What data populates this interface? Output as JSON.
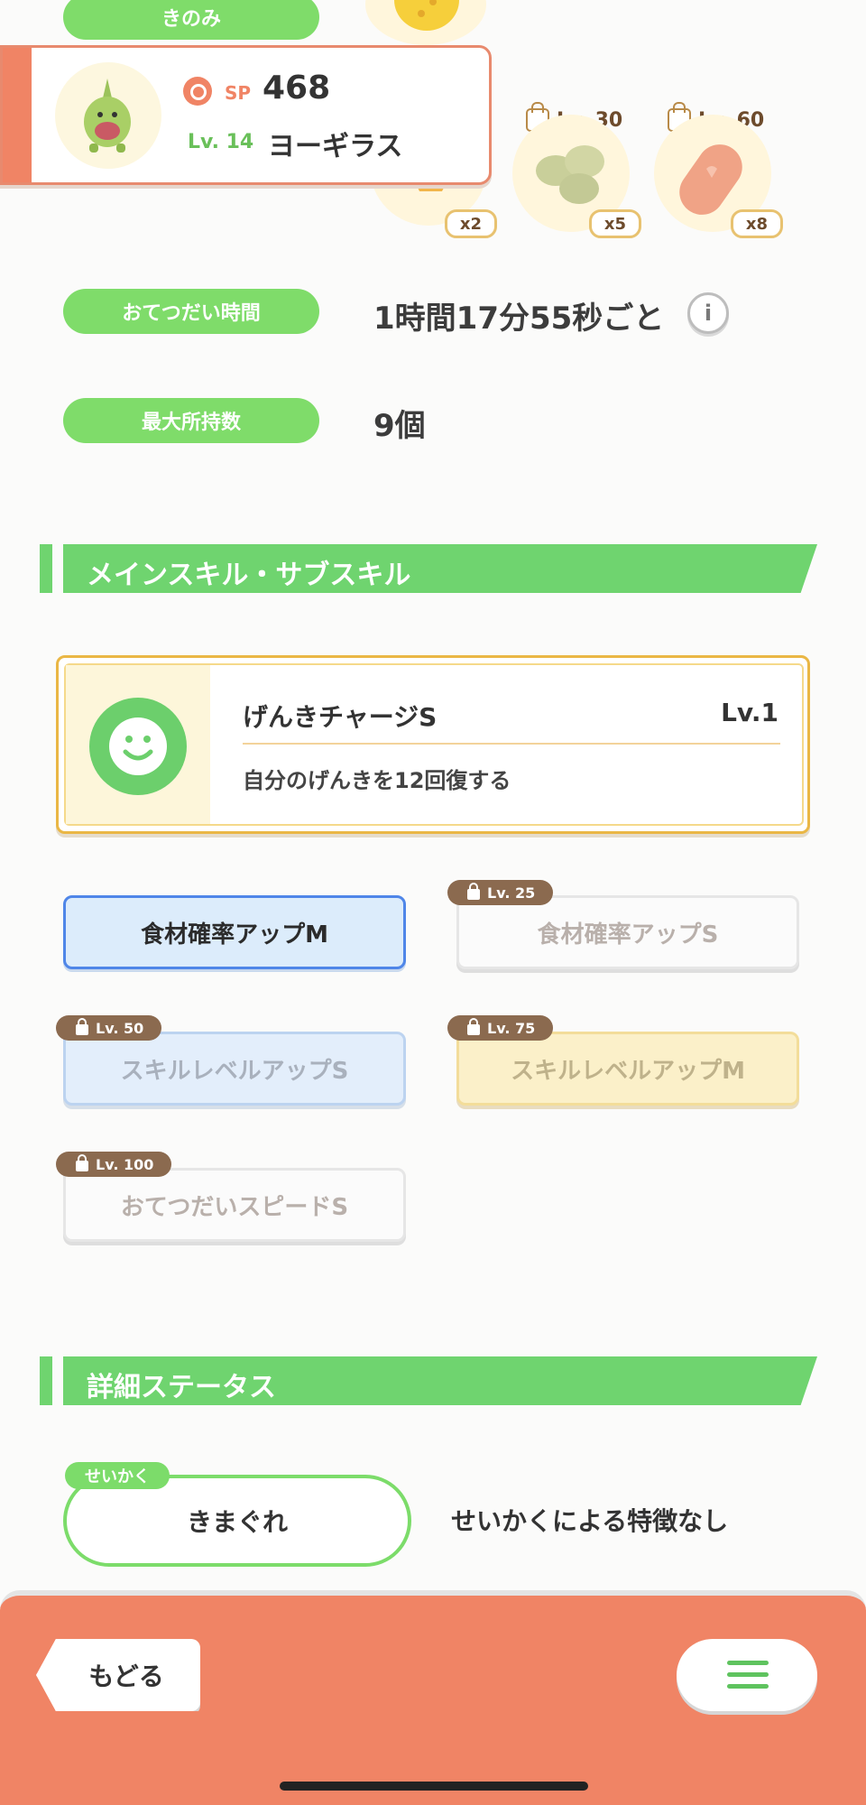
{
  "berry": {
    "label": "きのみ"
  },
  "pokemon_card": {
    "sp_label": "SP",
    "sp_value": "468",
    "level": "Lv. 14",
    "name": "ヨーギラス"
  },
  "ingredients": [
    {
      "lock": "",
      "count": "x2"
    },
    {
      "lock": "Lv. 30",
      "count": "x5"
    },
    {
      "lock": "Lv. 60",
      "count": "x8"
    }
  ],
  "help_time": {
    "label": "おてつだい時間",
    "value": "1時間17分55秒ごと"
  },
  "max_carry": {
    "label": "最大所持数",
    "value": "9個"
  },
  "skills_section": {
    "title": "メインスキル・サブスキル"
  },
  "main_skill": {
    "name": "げんきチャージS",
    "level": "Lv.1",
    "desc": "自分のげんきを12回復する"
  },
  "subskills": [
    {
      "lock": "",
      "label": "食材確率アップM"
    },
    {
      "lock": "Lv. 25",
      "label": "食材確率アップS"
    },
    {
      "lock": "Lv. 50",
      "label": "スキルレベルアップS"
    },
    {
      "lock": "Lv. 75",
      "label": "スキルレベルアップM"
    },
    {
      "lock": "Lv. 100",
      "label": "おてつだいスピードS"
    }
  ],
  "detail_section": {
    "title": "詳細ステータス"
  },
  "nature": {
    "tag": "せいかく",
    "value": "きまぐれ",
    "desc": "せいかくによる特徴なし"
  },
  "footer": {
    "back_label": "もどる",
    "menu_icon": "hamburger-menu-icon"
  },
  "colors": {
    "accent_green": "#6fd46f",
    "footer_orange": "#f08465",
    "card_border": "#e88a6e"
  }
}
